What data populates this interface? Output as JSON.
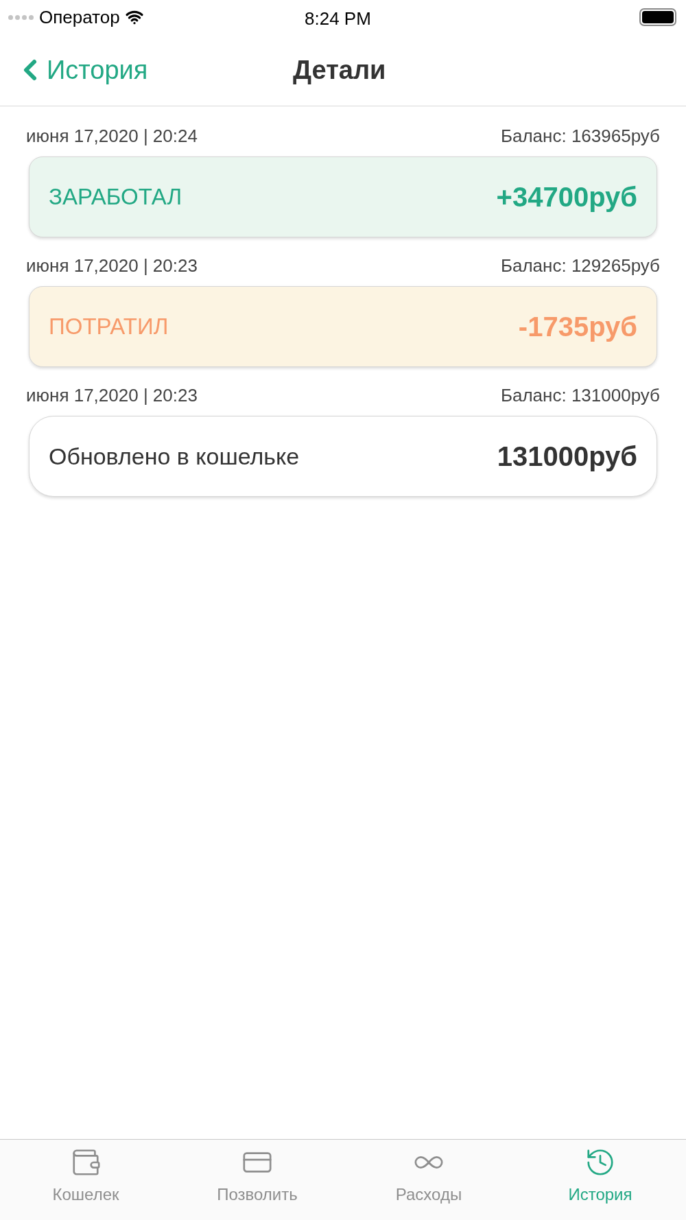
{
  "status_bar": {
    "carrier": "Оператор",
    "time": "8:24 PM"
  },
  "nav": {
    "back": "История",
    "title": "Детали"
  },
  "entries": [
    {
      "date": "июня 17,2020 | 20:24",
      "balance": "Баланс: 163965руб",
      "kind": "earned",
      "label": "ЗАРАБОТАЛ",
      "amount": "+34700руб"
    },
    {
      "date": "июня 17,2020 | 20:23",
      "balance": "Баланс: 129265руб",
      "kind": "spent",
      "label": "ПОТРАТИЛ",
      "amount": "-1735руб"
    },
    {
      "date": "июня 17,2020 | 20:23",
      "balance": "Баланс: 131000руб",
      "kind": "updated",
      "label": "Обновлено в кошельке",
      "amount": "131000руб"
    }
  ],
  "tabs": [
    {
      "label": "Кошелек",
      "kind": "wallet",
      "selected": false
    },
    {
      "label": "Позволить",
      "kind": "card",
      "selected": false
    },
    {
      "label": "Расходы",
      "kind": "loop",
      "selected": false
    },
    {
      "label": "История",
      "kind": "history",
      "selected": true
    }
  ]
}
